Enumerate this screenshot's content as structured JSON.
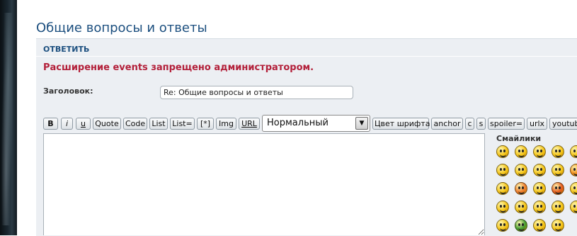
{
  "page": {
    "title": "Общие вопросы и ответы"
  },
  "panel": {
    "reply_header": "ОТВЕТИТЬ",
    "warning": "Расширение events запрещено администратором.",
    "subject_label": "Заголовок:",
    "subject_value": "Re: Общие вопросы и ответы"
  },
  "toolbar": {
    "buttons": [
      "B",
      "i",
      "u",
      "Quote",
      "Code",
      "List",
      "List=",
      "[*]",
      "Img",
      "URL"
    ],
    "size_select": "Нормальный",
    "buttons2": [
      "Цвет шрифта",
      "anchor",
      "c",
      "s",
      "spoiler=",
      "urlx",
      "youtube"
    ]
  },
  "smilies": {
    "title": "Смайлики",
    "icons": [
      {
        "name": "grin-smiley-icon",
        "color": "#f5c518"
      },
      {
        "name": "happy-smiley-icon",
        "color": "#f5c518"
      },
      {
        "name": "wink-smiley-icon",
        "color": "#f5c518"
      },
      {
        "name": "surprised-smiley-icon",
        "color": "#f5c518"
      },
      {
        "name": "laugh-smiley-icon",
        "color": "#f5c518"
      },
      {
        "name": "glasses-smiley-icon",
        "color": "#f5c518"
      },
      {
        "name": "confused-smiley-icon",
        "color": "#f5c518"
      },
      {
        "name": "cool-smiley-icon",
        "color": "#f5c518"
      },
      {
        "name": "tongue-smiley-icon",
        "color": "#f5c518"
      },
      {
        "name": "angry-smiley-icon",
        "color": "#f08a16"
      },
      {
        "name": "smile-smiley-icon",
        "color": "#f5c518"
      },
      {
        "name": "sad-smiley-icon",
        "color": "#ee7a2a"
      },
      {
        "name": "neutral-smiley-icon",
        "color": "#f5c518"
      },
      {
        "name": "evil-smiley-icon",
        "color": "#e55a1c"
      },
      {
        "name": "mad-smiley-icon",
        "color": "#f5c518"
      },
      {
        "name": "eek-smiley-icon",
        "color": "#f5c518"
      },
      {
        "name": "exclaim-icon",
        "color": "#f5c518"
      },
      {
        "name": "question-icon",
        "color": "#f5c518"
      },
      {
        "name": "idea-icon",
        "color": "#f5c518"
      },
      {
        "name": "arrow-icon",
        "color": "#f5c518"
      },
      {
        "name": "rolleyes-smiley-icon",
        "color": "#f5c518"
      },
      {
        "name": "green-smiley-icon",
        "color": "#3f9b2d"
      },
      {
        "name": "teeth-smiley-icon",
        "color": "#f5c518"
      },
      {
        "name": "nerd-smiley-icon",
        "color": "#f5c518"
      }
    ]
  }
}
